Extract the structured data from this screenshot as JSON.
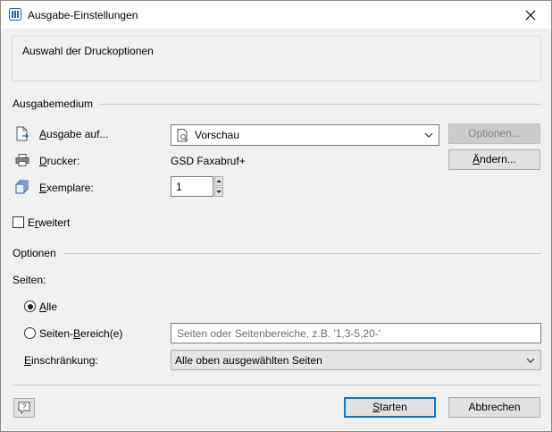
{
  "window": {
    "title": "Ausgabe-Einstellungen",
    "icon": "app-icon"
  },
  "info": {
    "text": "Auswahl der Druckoptionen"
  },
  "ausgabemedium": {
    "group_title": "Ausgabemedium",
    "ausgabe_label_accel": "A",
    "ausgabe_label_rest": "usgabe auf...",
    "ausgabe_value": "Vorschau",
    "optionen_button": "Optionen...",
    "drucker_label_accel": "D",
    "drucker_label_rest": "rucker:",
    "drucker_value": "GSD Faxabruf+",
    "aendern_button_accel": "Ä",
    "aendern_button_rest": "ndern...",
    "exemplare_label_accel": "E",
    "exemplare_label_rest": "xemplare:",
    "exemplare_value": "1"
  },
  "erweitert": {
    "label_pre": "E",
    "label_accel": "r",
    "label_rest": "weitert",
    "checked": false
  },
  "optionen": {
    "group_title": "Optionen",
    "seiten_label": "Seiten:",
    "alle_label_accel": "A",
    "alle_label_rest": "lle",
    "bereich_label_pre": "Seiten-",
    "bereich_label_accel": "B",
    "bereich_label_rest": "ereich(e)",
    "bereich_placeholder": "Seiten oder Seitenbereiche, z.B. '1,3-5,20-'",
    "einschraenkung_label_accel": "E",
    "einschraenkung_label_rest": "inschränkung:",
    "einschraenkung_value": "Alle oben ausgewählten Seiten"
  },
  "footer": {
    "starten_accel": "S",
    "starten_rest": "tarten",
    "abbrechen": "Abbrechen"
  },
  "colors": {
    "accent": "#0078d7",
    "dialog_bg": "#f0f0f0",
    "icon_blue": "#1e5fa8"
  }
}
